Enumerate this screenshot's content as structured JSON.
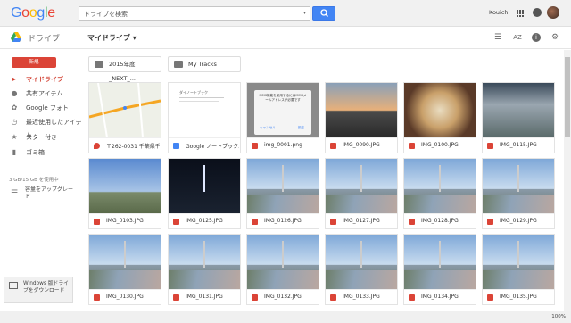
{
  "top": {
    "logo": "Google",
    "search_value": "ドライブを検索",
    "user": "Kouichi"
  },
  "header": {
    "app_title": "ドライブ",
    "location": "マイドライブ ▾",
    "sort_label": "AZ"
  },
  "sidebar": {
    "new_label": "新規",
    "items": [
      {
        "label": "マイドライブ",
        "icon": "drive-folder-icon",
        "glyph": "▸"
      },
      {
        "label": "共有アイテム",
        "icon": "people-icon",
        "glyph": "👥"
      },
      {
        "label": "Google フォト",
        "icon": "photos-icon",
        "glyph": "✿"
      },
      {
        "label": "最近使用したアイテム",
        "icon": "clock-icon",
        "glyph": "◷"
      },
      {
        "label": "スター付き",
        "icon": "star-icon",
        "glyph": "★"
      },
      {
        "label": "ゴミ箱",
        "icon": "trash-icon",
        "glyph": "🗑"
      }
    ],
    "storage": "3 GB/15 GB を使用中",
    "upgrade": "容量をアップグレード",
    "windows": "Windows 版ドライブをダウンロード"
  },
  "folders": [
    {
      "label": "2015年度_NEXT_..."
    },
    {
      "label": "My Tracks"
    }
  ],
  "files": [
    {
      "label": "〒262-0031 千葉県千...",
      "type": "map"
    },
    {
      "label": "Google ノートブック...",
      "type": "doc"
    },
    {
      "label": "img_0001.png",
      "type": "img"
    },
    {
      "label": "IMG_0090.JPG",
      "type": "img"
    },
    {
      "label": "IMG_0100.JPG",
      "type": "img"
    },
    {
      "label": "IMG_0115.JPG",
      "type": "img"
    },
    {
      "label": "IMG_0103.JPG",
      "type": "img"
    },
    {
      "label": "IMG_0125.JPG",
      "type": "img"
    },
    {
      "label": "IMG_0126.JPG",
      "type": "img"
    },
    {
      "label": "IMG_0127.JPG",
      "type": "img"
    },
    {
      "label": "IMG_0128.JPG",
      "type": "img"
    },
    {
      "label": "IMG_0129.JPG",
      "type": "img"
    },
    {
      "label": "IMG_0130.JPG",
      "type": "img"
    },
    {
      "label": "IMG_0131.JPG",
      "type": "img"
    },
    {
      "label": "IMG_0132.JPG",
      "type": "img"
    },
    {
      "label": "IMG_0133.JPG",
      "type": "img"
    },
    {
      "label": "IMG_0134.JPG",
      "type": "img"
    },
    {
      "label": "IMG_0135.JPG",
      "type": "img"
    }
  ],
  "dialog_thumb": {
    "text": "MMS機能を使用するにはMMSメールアドレスが必要です",
    "cancel": "キャンセル",
    "ok": "設定"
  },
  "notebook_thumb": {
    "title": "ダイノートブック"
  },
  "status": {
    "zoom": "100%"
  }
}
